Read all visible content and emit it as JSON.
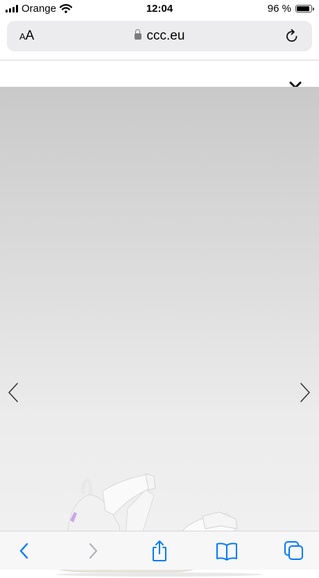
{
  "status_bar": {
    "carrier": "Orange",
    "time": "12:04",
    "battery": "96 %",
    "battery_level": 0.96
  },
  "address_bar": {
    "text_size_large": "A",
    "text_size_small": "A",
    "url": "ccc.eu"
  },
  "icons": {
    "close": "close-icon",
    "prev": "chevron-left-icon",
    "next": "chevron-right-icon",
    "reload": "reload-icon",
    "lock": "lock-icon",
    "back": "back-icon",
    "forward": "forward-icon",
    "share": "share-icon",
    "bookmarks": "bookmarks-icon",
    "tabs": "tabs-icon"
  },
  "colors": {
    "accent": "#007aff",
    "disabled": "#b5b5ba",
    "gallery_top": "#c9c9c9",
    "gallery_bottom": "#f0f0f0"
  }
}
